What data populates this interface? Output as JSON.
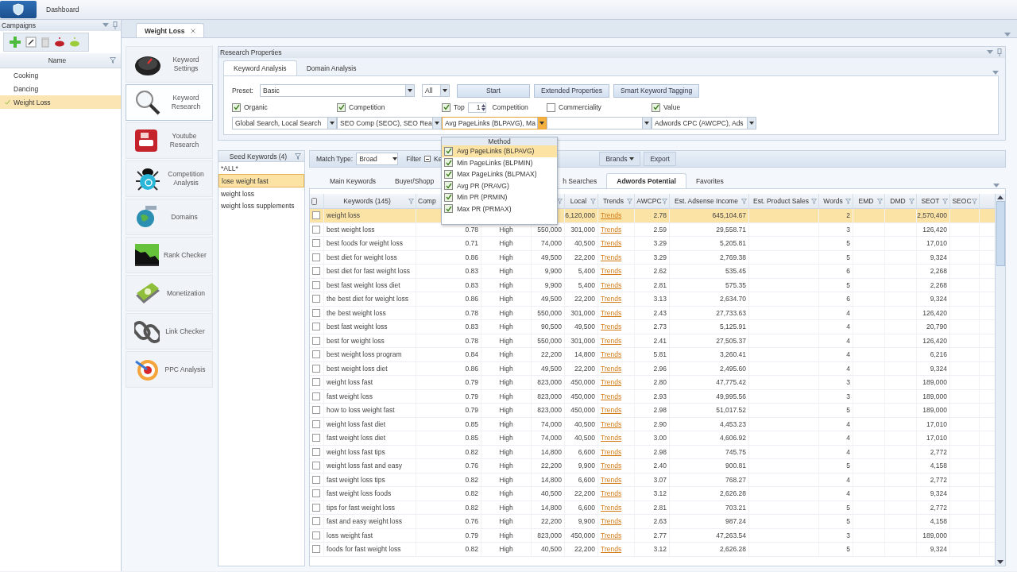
{
  "topbar": {
    "tab": "Dashboard"
  },
  "campaigns": {
    "title": "Campaigns",
    "column": "Name",
    "items": [
      {
        "label": "Cooking",
        "selected": false
      },
      {
        "label": "Dancing",
        "selected": false
      },
      {
        "label": "Weight Loss",
        "selected": true
      }
    ]
  },
  "document_tab": {
    "label": "Weight Loss"
  },
  "tools": [
    {
      "label": "Keyword Settings",
      "kind": "gauge",
      "selected": false
    },
    {
      "label": "Keyword Research",
      "kind": "magnifier",
      "selected": true
    },
    {
      "label": "Youtube Research",
      "kind": "video",
      "selected": false
    },
    {
      "label": "Competition Analysis",
      "kind": "bug",
      "selected": false
    },
    {
      "label": "Domains",
      "kind": "globe",
      "selected": false
    },
    {
      "label": "Rank Checker",
      "kind": "chart",
      "selected": false
    },
    {
      "label": "Monetization",
      "kind": "money",
      "selected": false
    },
    {
      "label": "Link Checker",
      "kind": "chain",
      "selected": false
    },
    {
      "label": "PPC Analysis",
      "kind": "target",
      "selected": false
    }
  ],
  "research_properties": {
    "title": "Research Properties",
    "tabs": [
      {
        "label": "Keyword Analysis",
        "selected": true
      },
      {
        "label": "Domain Analysis",
        "selected": false
      }
    ],
    "preset_label": "Preset:",
    "preset": "Basic",
    "scope": "All",
    "buttons": [
      "Start",
      "Extended Properties",
      "Smart Keyword Tagging"
    ],
    "options": [
      {
        "label": "Organic",
        "checked": true,
        "select": "Global Search, Local Search",
        "focused": false
      },
      {
        "label": "Competition",
        "checked": true,
        "select": "SEO Comp (SEOC), SEO Rea",
        "focused": false
      },
      {
        "label": "Top",
        "checked": true,
        "spin": "1",
        "suffix": "Competition",
        "select": "Avg PageLinks (BLPAVG), Ma",
        "focused": true
      },
      {
        "label": "Commerciality",
        "checked": false,
        "focused": false
      },
      {
        "label": "Value",
        "checked": true,
        "select": "Adwords CPC (AWCPC), Ads",
        "focused": false
      }
    ]
  },
  "method_menu": {
    "title": "Method",
    "items": [
      {
        "label": "Avg PageLinks (BLPAVG)",
        "checked": true,
        "selected": true
      },
      {
        "label": "Min PageLinks (BLPMIN)",
        "checked": true,
        "selected": false
      },
      {
        "label": "Max PageLinks (BLPMAX)",
        "checked": true,
        "selected": false
      },
      {
        "label": "Avg PR (PRAVG)",
        "checked": true,
        "selected": false
      },
      {
        "label": "Min PR (PRMIN)",
        "checked": true,
        "selected": false
      },
      {
        "label": "Max PR (PRMAX)",
        "checked": true,
        "selected": false
      }
    ]
  },
  "seed_keywords": {
    "title": "Seed Keywords (4)",
    "items": [
      {
        "label": "*ALL*",
        "selected": false
      },
      {
        "label": "lose weight fast",
        "selected": true
      },
      {
        "label": "weight loss",
        "selected": false
      },
      {
        "label": "weight loss supplements",
        "selected": false
      }
    ]
  },
  "results": {
    "match_type_label": "Match Type:",
    "match_type": "Broad",
    "filter_label": "Filter",
    "filter_indeterminate": true,
    "filter_text": "Ke",
    "brands": "Brands",
    "export": "Export",
    "tabs": [
      {
        "label": "Main Keywords",
        "selected": false
      },
      {
        "label": "Buyer/Shopp",
        "selected": false
      },
      {
        "label": "h Searches",
        "selected": false
      },
      {
        "label": "Adwords Potential",
        "selected": true
      },
      {
        "label": "Favorites",
        "selected": false
      }
    ],
    "table": {
      "columns": [
        {
          "label": "Keywords (145)",
          "filter": true
        },
        {
          "label": "Comp"
        },
        {},
        {
          "filter": true
        },
        {
          "label": "Local",
          "filter": true
        },
        {
          "label": "Trends",
          "filter": true
        },
        {
          "label": "AWCPC",
          "filter": true
        },
        {
          "label": "Est. Adsense Income",
          "filter": true
        },
        {
          "label": "Est. Product Sales",
          "filter": true
        },
        {
          "label": "Words",
          "filter": true
        },
        {
          "label": "EMD",
          "filter": true
        },
        {
          "label": "DMD",
          "filter": true
        },
        {
          "label": "SEOT",
          "filter": true
        },
        {
          "label": "SEOC",
          "filter": true
        }
      ],
      "rows": [
        {
          "selected": true,
          "checked": false,
          "keyword": "weight loss",
          "local": "6,120,000",
          "trends": "Trends",
          "awcpc": "2.78",
          "adsense": "645,104.67",
          "words": "2",
          "seot": "2,570,400"
        },
        {
          "selected": false,
          "checked": false,
          "keyword": "best weight loss",
          "comp": "0.78",
          "competition": "High",
          "global": "550,000",
          "local": "301,000",
          "trends": "Trends",
          "awcpc": "2.59",
          "adsense": "29,558.71",
          "words": "3",
          "seot": "126,420"
        },
        {
          "selected": false,
          "checked": false,
          "keyword": "best foods for weight loss",
          "comp": "0.71",
          "competition": "High",
          "global": "74,000",
          "local": "40,500",
          "trends": "Trends",
          "awcpc": "3.29",
          "adsense": "5,205.81",
          "words": "5",
          "seot": "17,010"
        },
        {
          "selected": false,
          "checked": false,
          "keyword": "best diet for weight loss",
          "comp": "0.86",
          "competition": "High",
          "global": "49,500",
          "local": "22,200",
          "trends": "Trends",
          "awcpc": "3.29",
          "adsense": "2,769.38",
          "words": "5",
          "seot": "9,324"
        },
        {
          "selected": false,
          "checked": false,
          "keyword": "best diet for fast weight loss",
          "comp": "0.83",
          "competition": "High",
          "global": "9,900",
          "local": "5,400",
          "trends": "Trends",
          "awcpc": "2.62",
          "adsense": "535.45",
          "words": "6",
          "seot": "2,268"
        },
        {
          "selected": false,
          "checked": false,
          "keyword": "best fast weight loss diet",
          "comp": "0.83",
          "competition": "High",
          "global": "9,900",
          "local": "5,400",
          "trends": "Trends",
          "awcpc": "2.81",
          "adsense": "575.35",
          "words": "5",
          "seot": "2,268"
        },
        {
          "selected": false,
          "checked": false,
          "keyword": "the best diet for weight loss",
          "comp": "0.86",
          "competition": "High",
          "global": "49,500",
          "local": "22,200",
          "trends": "Trends",
          "awcpc": "3.13",
          "adsense": "2,634.70",
          "words": "6",
          "seot": "9,324"
        },
        {
          "selected": false,
          "checked": false,
          "keyword": "the best weight loss",
          "comp": "0.78",
          "competition": "High",
          "global": "550,000",
          "local": "301,000",
          "trends": "Trends",
          "awcpc": "2.43",
          "adsense": "27,733.63",
          "words": "4",
          "seot": "126,420"
        },
        {
          "selected": false,
          "checked": false,
          "keyword": "best fast weight loss",
          "comp": "0.83",
          "competition": "High",
          "global": "90,500",
          "local": "49,500",
          "trends": "Trends",
          "awcpc": "2.73",
          "adsense": "5,125.91",
          "words": "4",
          "seot": "20,790"
        },
        {
          "selected": false,
          "checked": false,
          "keyword": "best for weight loss",
          "comp": "0.78",
          "competition": "High",
          "global": "550,000",
          "local": "301,000",
          "trends": "Trends",
          "awcpc": "2.41",
          "adsense": "27,505.37",
          "words": "4",
          "seot": "126,420"
        },
        {
          "selected": false,
          "checked": false,
          "keyword": "best weight loss program",
          "comp": "0.84",
          "competition": "High",
          "global": "22,200",
          "local": "14,800",
          "trends": "Trends",
          "awcpc": "5.81",
          "adsense": "3,260.41",
          "words": "4",
          "seot": "6,216"
        },
        {
          "selected": false,
          "checked": false,
          "keyword": "best weight loss diet",
          "comp": "0.86",
          "competition": "High",
          "global": "49,500",
          "local": "22,200",
          "trends": "Trends",
          "awcpc": "2.96",
          "adsense": "2,495.60",
          "words": "4",
          "seot": "9,324"
        },
        {
          "selected": false,
          "checked": false,
          "keyword": "weight loss fast",
          "comp": "0.79",
          "competition": "High",
          "global": "823,000",
          "local": "450,000",
          "trends": "Trends",
          "awcpc": "2.80",
          "adsense": "47,775.42",
          "words": "3",
          "seot": "189,000"
        },
        {
          "selected": false,
          "checked": false,
          "keyword": "fast weight loss",
          "comp": "0.79",
          "competition": "High",
          "global": "823,000",
          "local": "450,000",
          "trends": "Trends",
          "awcpc": "2.93",
          "adsense": "49,995.56",
          "words": "3",
          "seot": "189,000"
        },
        {
          "selected": false,
          "checked": false,
          "keyword": "how to loss weight fast",
          "comp": "0.79",
          "competition": "High",
          "global": "823,000",
          "local": "450,000",
          "trends": "Trends",
          "awcpc": "2.98",
          "adsense": "51,017.52",
          "words": "5",
          "seot": "189,000"
        },
        {
          "selected": false,
          "checked": false,
          "keyword": "weight loss fast diet",
          "comp": "0.85",
          "competition": "High",
          "global": "74,000",
          "local": "40,500",
          "trends": "Trends",
          "awcpc": "2.90",
          "adsense": "4,453.23",
          "words": "4",
          "seot": "17,010"
        },
        {
          "selected": false,
          "checked": false,
          "keyword": "fast weight loss diet",
          "comp": "0.85",
          "competition": "High",
          "global": "74,000",
          "local": "40,500",
          "trends": "Trends",
          "awcpc": "3.00",
          "adsense": "4,606.92",
          "words": "4",
          "seot": "17,010"
        },
        {
          "selected": false,
          "checked": false,
          "keyword": "weight loss fast tips",
          "comp": "0.82",
          "competition": "High",
          "global": "14,800",
          "local": "6,600",
          "trends": "Trends",
          "awcpc": "2.98",
          "adsense": "745.75",
          "words": "4",
          "seot": "2,772"
        },
        {
          "selected": false,
          "checked": false,
          "keyword": "weight loss fast and easy",
          "comp": "0.76",
          "competition": "High",
          "global": "22,200",
          "local": "9,900",
          "trends": "Trends",
          "awcpc": "2.40",
          "adsense": "900.81",
          "words": "5",
          "seot": "4,158"
        },
        {
          "selected": false,
          "checked": false,
          "keyword": "fast weight loss tips",
          "comp": "0.82",
          "competition": "High",
          "global": "14,800",
          "local": "6,600",
          "trends": "Trends",
          "awcpc": "3.07",
          "adsense": "768.27",
          "words": "4",
          "seot": "2,772"
        },
        {
          "selected": false,
          "checked": false,
          "keyword": "fast weight loss foods",
          "comp": "0.82",
          "competition": "High",
          "global": "40,500",
          "local": "22,200",
          "trends": "Trends",
          "awcpc": "3.12",
          "adsense": "2,626.28",
          "words": "4",
          "seot": "9,324"
        },
        {
          "selected": false,
          "checked": false,
          "keyword": "tips for fast weight loss",
          "comp": "0.82",
          "competition": "High",
          "global": "14,800",
          "local": "6,600",
          "trends": "Trends",
          "awcpc": "2.81",
          "adsense": "703.21",
          "words": "5",
          "seot": "2,772"
        },
        {
          "selected": false,
          "checked": false,
          "keyword": "fast and easy weight loss",
          "comp": "0.76",
          "competition": "High",
          "global": "22,200",
          "local": "9,900",
          "trends": "Trends",
          "awcpc": "2.63",
          "adsense": "987.24",
          "words": "5",
          "seot": "4,158"
        },
        {
          "selected": false,
          "checked": false,
          "keyword": "loss weight fast",
          "comp": "0.79",
          "competition": "High",
          "global": "823,000",
          "local": "450,000",
          "trends": "Trends",
          "awcpc": "2.77",
          "adsense": "47,263.54",
          "words": "3",
          "seot": "189,000"
        },
        {
          "selected": false,
          "checked": false,
          "keyword": "foods for fast weight loss",
          "comp": "0.82",
          "competition": "High",
          "global": "40,500",
          "local": "22,200",
          "trends": "Trends",
          "awcpc": "3.12",
          "adsense": "2,626.28",
          "words": "5",
          "seot": "9,324"
        }
      ]
    }
  }
}
